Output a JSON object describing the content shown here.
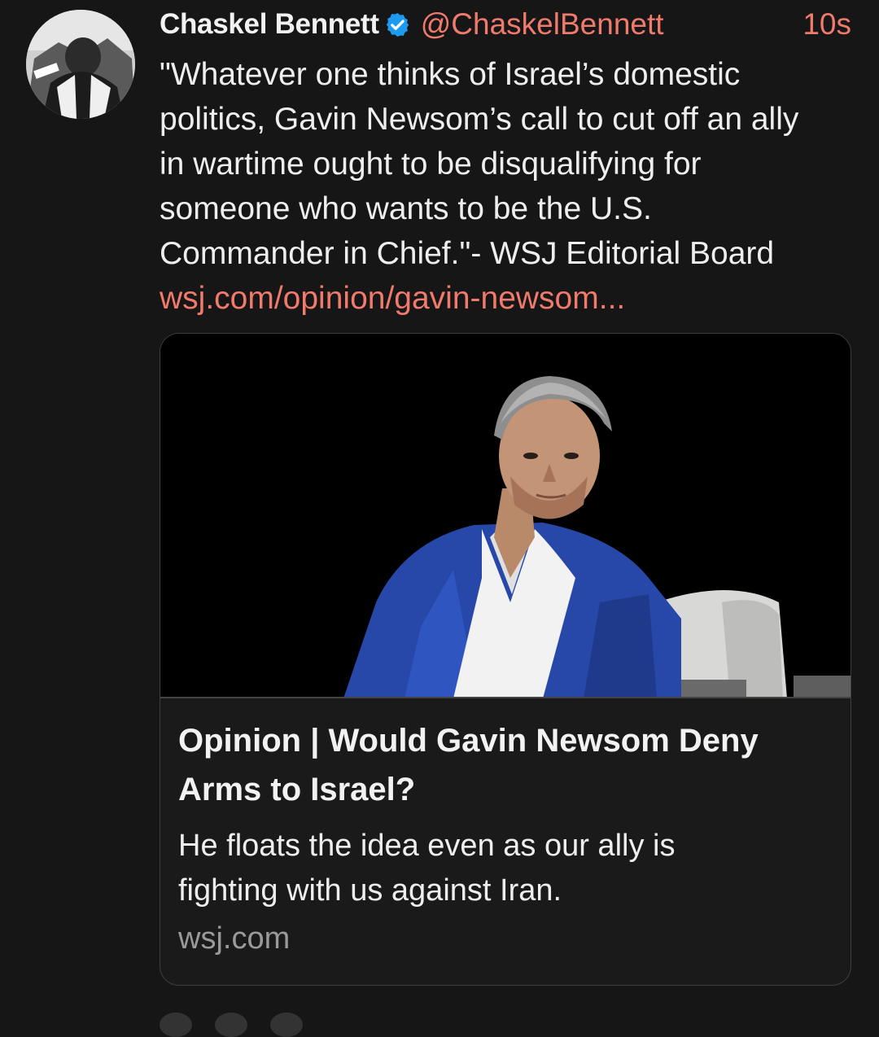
{
  "post": {
    "author": {
      "display_name": "Chaskel Bennett",
      "handle": "@ChaskelBennett",
      "verified": true
    },
    "timestamp": "10s",
    "text_lines": [
      "\"Whatever one thinks of Israel’s domestic",
      "politics, Gavin Newsom’s call to cut off an ally",
      "in wartime ought to be disqualifying for",
      "someone who wants to be the U.S.",
      "Commander in Chief.\"- WSJ Editorial Board"
    ],
    "link_text": "wsj.com/opinion/gavin-newsom..."
  },
  "link_card": {
    "title_lines": [
      "Opinion | Would Gavin Newsom Deny",
      "Arms to Israel?"
    ],
    "description_lines": [
      "He floats the idea even as our ally is",
      "fighting with us against Iran."
    ],
    "domain": "wsj.com"
  },
  "colors": {
    "background": "#161616",
    "accent": "#f07a6c",
    "verified_badge": "#1d9bf0",
    "muted_text": "#9a9a9a"
  },
  "icons": {
    "verified": "verified-badge-icon"
  }
}
